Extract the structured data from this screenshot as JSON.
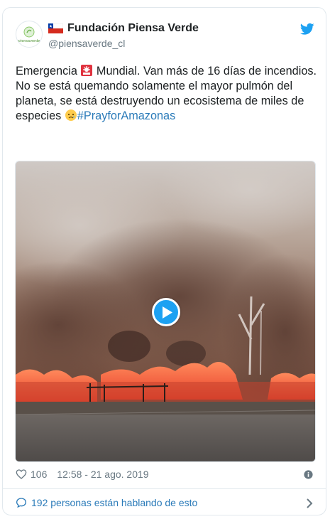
{
  "author": {
    "name": "Fundación Piensa Verde",
    "handle": "@piensaverde_cl",
    "avatar_text": "piensaverde"
  },
  "tweet": {
    "text_1": "Emergencia ",
    "text_2": " Mundial.  Van más de 16 días de incendios.  No se está quemando solamente el mayor pulmón del planeta, se está destruyendo un ecosistema de miles de especies ",
    "hashtag": "#PrayforAmazonas",
    "emoji_1": "police-light",
    "emoji_2": "crying-face"
  },
  "meta": {
    "likes": "106",
    "timestamp": "12:58 - 21 ago. 2019"
  },
  "footer": {
    "conversation": "192 personas están hablando de esto"
  },
  "colors": {
    "accent": "#1da1f2",
    "link": "#2b7bb9",
    "muted": "#697882",
    "border": "#e1e8ed"
  },
  "icons": [
    "chile-flag-icon",
    "twitter-bird-icon",
    "play-icon",
    "heart-icon",
    "info-icon",
    "speech-bubble-icon",
    "chevron-right-icon"
  ]
}
